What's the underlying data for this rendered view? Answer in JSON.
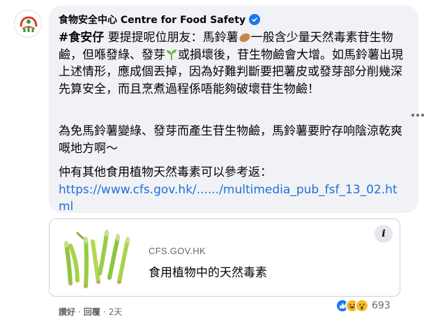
{
  "comment": {
    "author": "食物安全中心 Centre for Food Safety",
    "hashtag": "#食安仔",
    "p1_a": " 要提提呢位朋友：馬鈴薯",
    "p1_b": "一般含少量天然毒素苷生物鹼，但喺發綠、發芽",
    "p1_c": "或損壞後，苷生物鹼會大增。如馬鈴薯出現上述情形，應成個丟掉，因為好難判斷要把薯皮或發芽部分削幾深先算安全，而且烹煮過程係唔能夠破壞苷生物鹼！",
    "p2": "為免馬鈴薯變綠、發芽而產生苷生物鹼，馬鈴薯要貯存响陰涼乾爽嘅地方啊～",
    "p3": "仲有其他食用植物天然毒素可以參考返：",
    "link": "https://www.cfs.gov.hk/....../multimedia_pub_fsf_13_02.html"
  },
  "link_preview": {
    "domain": "CFS.GOV.HK",
    "title": "食用植物中的天然毒素",
    "info_label": "i"
  },
  "actions": {
    "like": "讚好",
    "reply": "回覆",
    "dot": "·",
    "time": "2天"
  },
  "reactions": {
    "count": "693",
    "icons": [
      "like-icon",
      "haha-icon",
      "wow-icon"
    ]
  },
  "colors": {
    "bubble": "#f0f2f5",
    "link": "#216fdb",
    "verified": "#1877f2",
    "secondary_text": "#65676b"
  }
}
